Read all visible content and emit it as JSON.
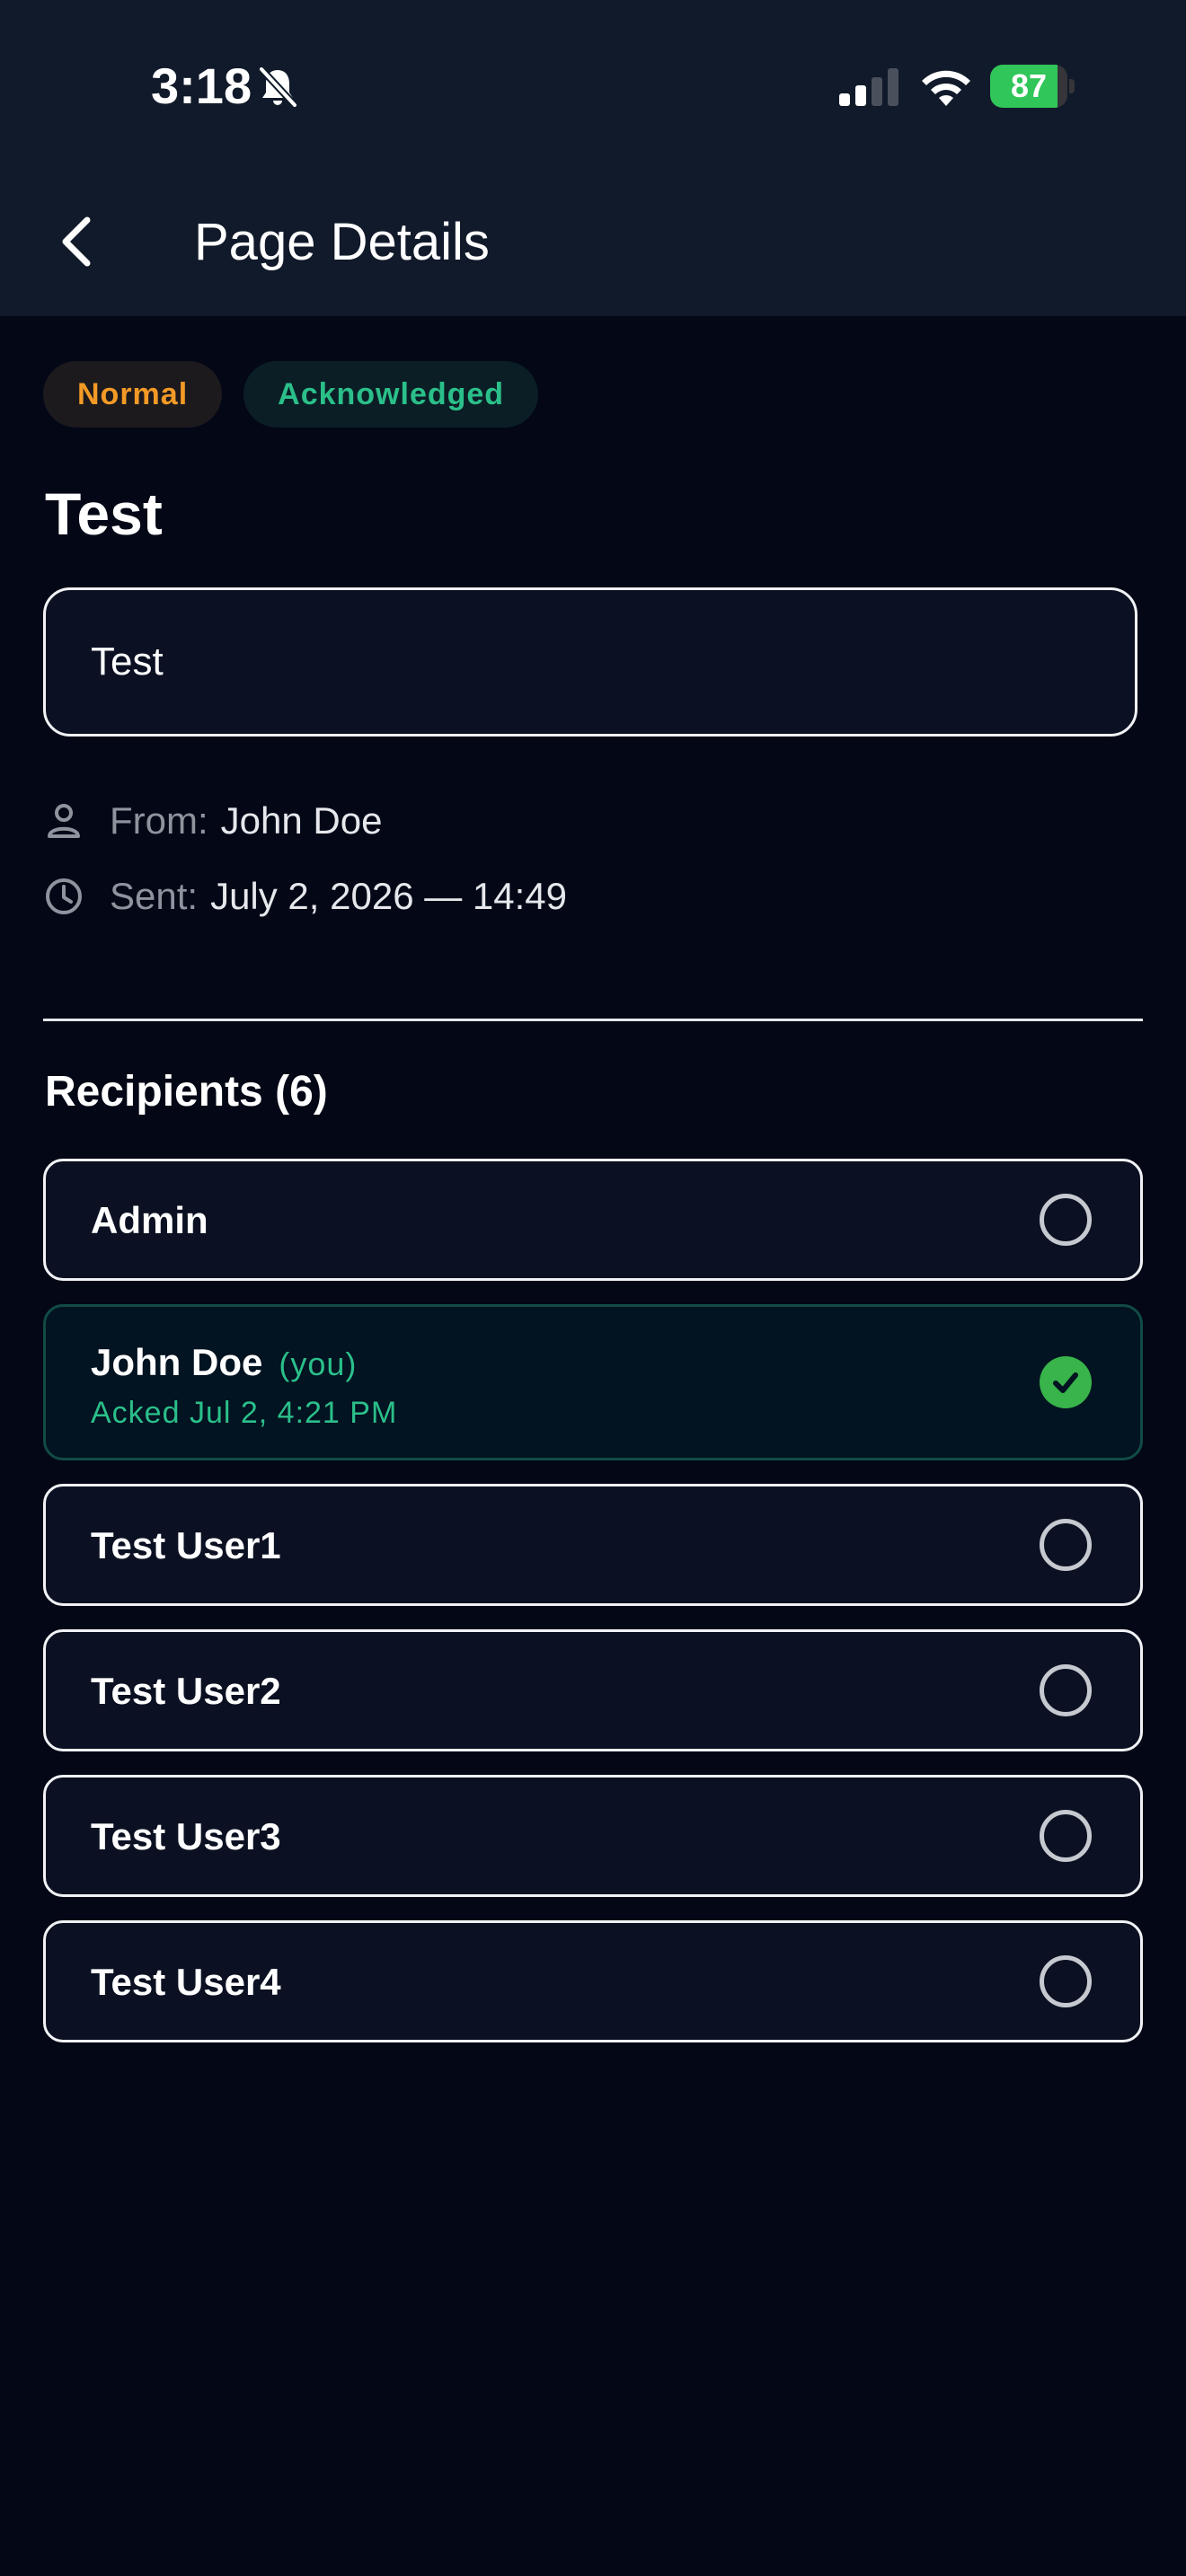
{
  "status_bar": {
    "time": "3:18",
    "battery_level": "87",
    "battery_fraction": 0.87,
    "signal_bars_active": 2,
    "signal_bars_total": 4,
    "icons": [
      "bell-slash-icon",
      "cellular-signal-icon",
      "wifi-icon",
      "battery-icon"
    ]
  },
  "header": {
    "title": "Page Details",
    "back_icon": "chevron-left-icon"
  },
  "badges": {
    "priority": "Normal",
    "status": "Acknowledged"
  },
  "message": {
    "title": "Test",
    "body": "Test"
  },
  "meta": {
    "from_label": "From:",
    "from_value": "John Doe",
    "from_icon": "person-icon",
    "sent_label": "Sent:",
    "sent_value": "July 2, 2026 — 14:49",
    "sent_icon": "clock-icon"
  },
  "recipients": {
    "heading": "Recipients (6)",
    "items": [
      {
        "name": "Admin",
        "acked": false
      },
      {
        "name": "John Doe",
        "you_label": "(you)",
        "ack_text": "Acked Jul 2, 4:21 PM",
        "acked": true
      },
      {
        "name": "Test User1",
        "acked": false
      },
      {
        "name": "Test User2",
        "acked": false
      },
      {
        "name": "Test User3",
        "acked": false
      },
      {
        "name": "Test User4",
        "acked": false
      }
    ]
  },
  "colors": {
    "background": "#030716",
    "header_background": "#111a2a",
    "priority_orange": "#f39a26",
    "acknowledged_green": "#2bbf8a",
    "check_green": "#38b44a",
    "battery_green": "#30c659"
  }
}
